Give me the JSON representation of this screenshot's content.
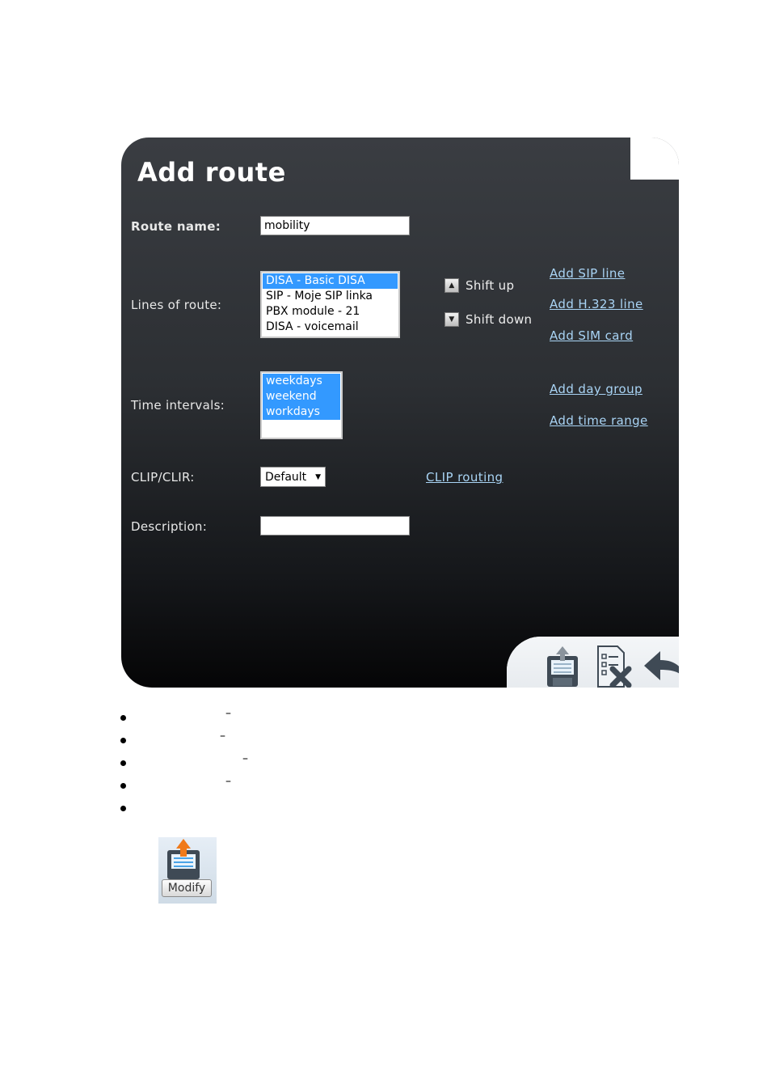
{
  "dialog": {
    "title": "Add route",
    "route_name_label": "Route name:",
    "route_name_value": "mobility",
    "lines_label": "Lines of route:",
    "lines": [
      {
        "text": "DISA - Basic DISA",
        "selected": true
      },
      {
        "text": "SIP - Moje SIP linka",
        "selected": false
      },
      {
        "text": "PBX module - 21",
        "selected": false
      },
      {
        "text": "DISA - voicemail",
        "selected": false
      }
    ],
    "shift_up_label": "Shift up",
    "shift_down_label": "Shift down",
    "add_sip_line": "Add SIP line",
    "add_h323_line": "Add H.323 line",
    "add_sim_card": "Add SIM card",
    "time_label": "Time intervals:",
    "time_intervals": [
      {
        "text": "weekdays",
        "selected": true
      },
      {
        "text": "weekend",
        "selected": true
      },
      {
        "text": "workdays",
        "selected": true
      }
    ],
    "add_day_group": "Add day group",
    "add_time_range": "Add time range",
    "clip_label": "CLIP/CLIR:",
    "clip_value": "Default",
    "clip_routing": "CLIP routing",
    "description_label": "Description:",
    "description_value": ""
  },
  "toolbar": {
    "icons": [
      "save-icon",
      "delete-icon",
      "back-icon"
    ]
  },
  "bullets": [
    {
      "dash": "–"
    },
    {
      "dash": "–"
    },
    {
      "dash": "–"
    },
    {
      "dash": "–"
    },
    {
      "dash": ""
    }
  ],
  "modify_button": {
    "label": "Modify"
  },
  "colors": {
    "selection": "#3399ff",
    "link": "#a9d4f5"
  }
}
